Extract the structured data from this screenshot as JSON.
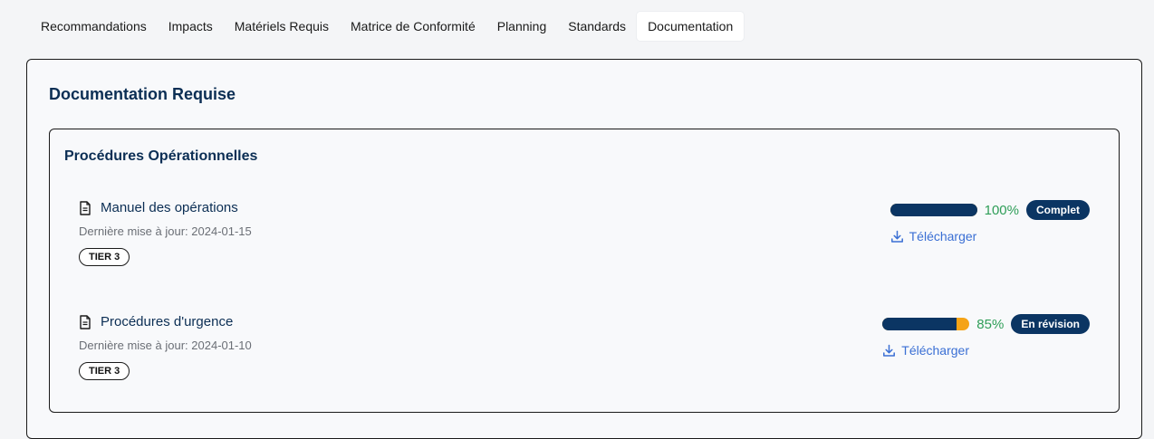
{
  "tabs": [
    {
      "label": "Recommandations",
      "active": false
    },
    {
      "label": "Impacts",
      "active": false
    },
    {
      "label": "Matériels Requis",
      "active": false
    },
    {
      "label": "Matrice de Conformité",
      "active": false
    },
    {
      "label": "Planning",
      "active": false
    },
    {
      "label": "Standards",
      "active": false
    },
    {
      "label": "Documentation",
      "active": true
    }
  ],
  "panel": {
    "title": "Documentation Requise"
  },
  "section": {
    "title": "Procédures Opérationnelles",
    "documents": [
      {
        "name": "Manuel des opérations",
        "date": "Dernière mise à jour: 2024-01-15",
        "tier": "TIER 3",
        "progress": 100,
        "progress_label": "100%",
        "status": "Complet",
        "download": "Télécharger"
      },
      {
        "name": "Procédures d'urgence",
        "date": "Dernière mise à jour: 2024-01-10",
        "tier": "TIER 3",
        "progress": 85,
        "progress_label": "85%",
        "status": "En révision",
        "download": "Télécharger"
      }
    ]
  },
  "colors": {
    "title": "#0b2e54",
    "bar_fill": "#0b3563",
    "bar_remaining": "#f5a316",
    "percent": "#2f9e58",
    "link": "#3a6fd4"
  }
}
